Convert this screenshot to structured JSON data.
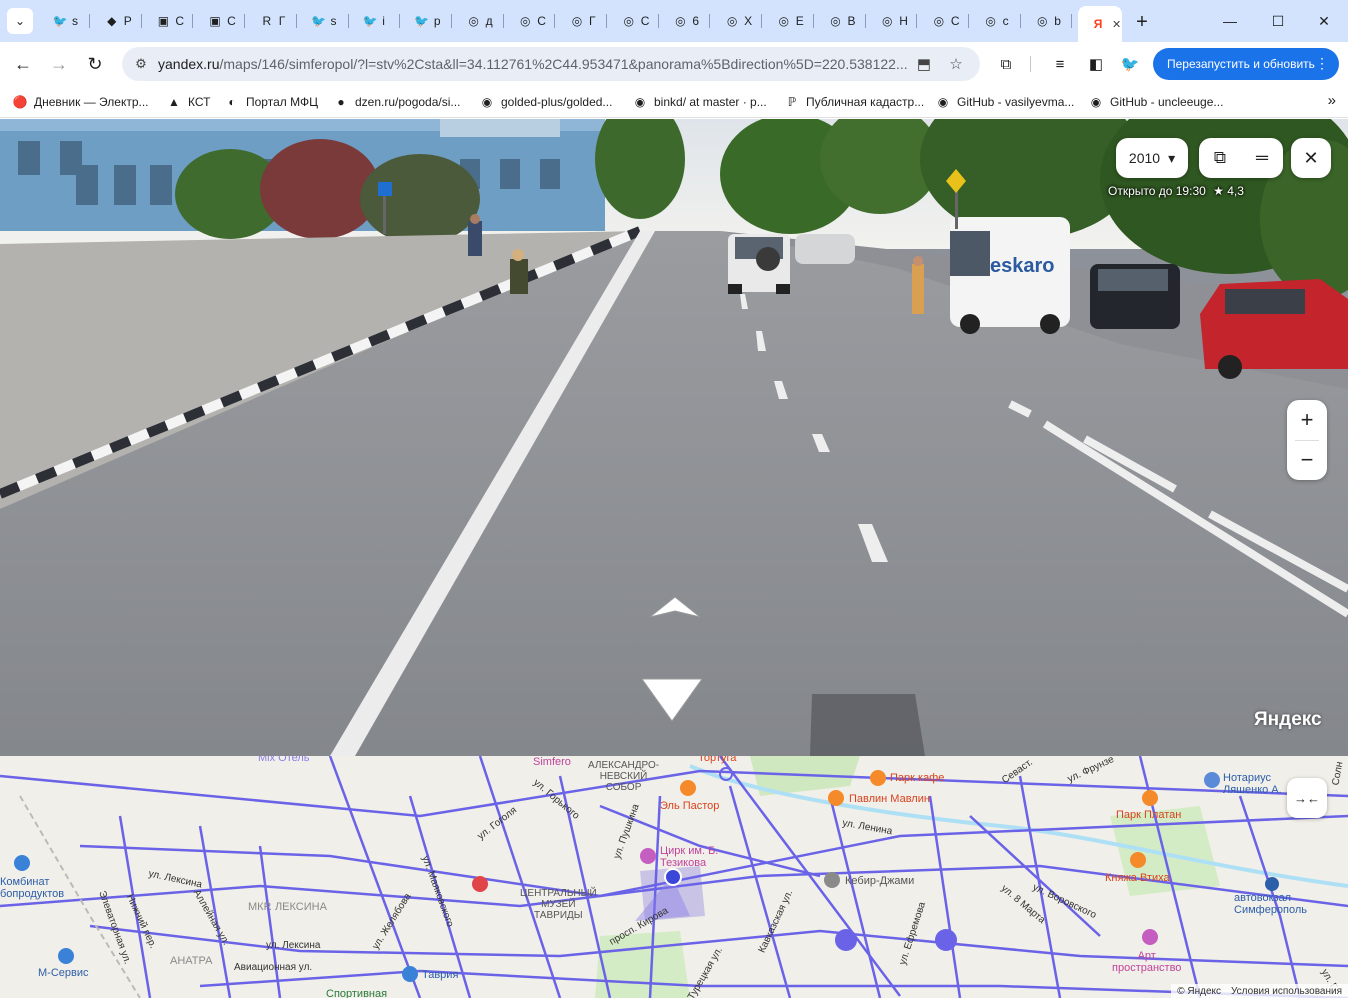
{
  "tabs": [
    {
      "fav": "🐦",
      "initial": "s"
    },
    {
      "fav": "◆",
      "initial": "P"
    },
    {
      "fav": "▣",
      "initial": "C"
    },
    {
      "fav": "▣",
      "initial": "C"
    },
    {
      "fav": "R",
      "initial": "Г"
    },
    {
      "fav": "🐦",
      "initial": "s"
    },
    {
      "fav": "🐦",
      "initial": "i"
    },
    {
      "fav": "🐦",
      "initial": "p"
    },
    {
      "fav": "◎",
      "initial": "д"
    },
    {
      "fav": "◎",
      "initial": "C"
    },
    {
      "fav": "◎",
      "initial": "Г"
    },
    {
      "fav": "◎",
      "initial": "C"
    },
    {
      "fav": "◎",
      "initial": "6"
    },
    {
      "fav": "◎",
      "initial": "X"
    },
    {
      "fav": "◎",
      "initial": "E"
    },
    {
      "fav": "◎",
      "initial": "B"
    },
    {
      "fav": "◎",
      "initial": "H"
    },
    {
      "fav": "◎",
      "initial": "C"
    },
    {
      "fav": "◎",
      "initial": "c"
    },
    {
      "fav": "◎",
      "initial": "b"
    }
  ],
  "active_tab": {
    "fav": "Я",
    "close": "✕"
  },
  "new_tab": "+",
  "window": {
    "minimize": "—",
    "maximize": "☐",
    "close": "✕"
  },
  "toolbar": {
    "back": "←",
    "forward": "→",
    "reload": "↻",
    "url_host": "yandex.ru",
    "url_path": "/maps/146/simferopol/?l=stv%2Csta&ll=34.112761%2C44.953471&panorama%5Bdirection%5D=220.538122...",
    "relaunch_label": "Перезапустить и обновить"
  },
  "bookmarks": [
    {
      "icon": "🔴",
      "label": "Дневник — Электр..."
    },
    {
      "icon": "▲",
      "label": "КСТ"
    },
    {
      "icon": "◐",
      "label": "Портал МФЦ"
    },
    {
      "icon": "●",
      "label": "dzen.ru/pogoda/si..."
    },
    {
      "icon": "◉",
      "label": "golded-plus/golded..."
    },
    {
      "icon": "◉",
      "label": "binkd/ at master · p..."
    },
    {
      "icon": "ℙ",
      "label": "Публичная кадастр..."
    },
    {
      "icon": "◉",
      "label": "GitHub - vasilyevma..."
    },
    {
      "icon": "◉",
      "label": "GitHub - uncleeuge..."
    }
  ],
  "bookmarks_more": "»",
  "panorama": {
    "year": "2010",
    "year_caret": "▾",
    "poi_hours": "Открыто до 19:30",
    "poi_rating": "★ 4,3",
    "van_text": "eskaro",
    "logo": "Яндекс",
    "zoom_in": "+",
    "zoom_out": "−"
  },
  "map": {
    "labels": {
      "mix_hotel": "Mix Отель",
      "simfero": "Simfero",
      "sobor": "АЛЕКСАНДРО-\nНЕВСКИЙ\nСОБОР",
      "tortuga": "Тортуга",
      "park_cafe": "Парк кафе",
      "pavlin": "Павлин Мавлин",
      "el_pastor": "Эль Пастор",
      "notarius": "Нотариус\nЛяшенко А.",
      "park_platan": "Парк Платан",
      "circus": "Цирк им. Б.\nТезикова",
      "kebir": "Кебир-Джами",
      "knyazha": "Княжа Втиха",
      "avtovokzal": "автовокзал\nСимферополь",
      "kombinat": "Комбинат\nбопродуктов",
      "museum": "ЦЕНТРАЛЬНЫЙ\nМУЗЕЙ\nТАВРИДЫ",
      "mkr_lieksina": "МКР. ЛЕКСИНА",
      "anatra": "АНАТРА",
      "m_service": "М-Сервис",
      "tavria": "Таврия",
      "sportivnaya": "Спортивная",
      "art": "Арт\nпространство",
      "st_lenina": "ул. Ленина",
      "st_gogolya": "ул. Гоголя",
      "st_gorkogo": "ул. Горького",
      "st_pushkina": "ул. Пушкина",
      "st_lieksina": "ул. Лексина",
      "st_lieksina2": "ул. Лексина",
      "st_zhelyabova": "ул. Желябова",
      "st_mayakovskogo": "ул. Маяковского",
      "st_kirova": "просп. Кирова",
      "st_aviacionnaya": "Авиационная ул.",
      "st_efremova": "ул. Ефремова",
      "st_8marta": "ул. 8 Марта",
      "st_vorovskogo": "ул. Воровского",
      "st_frunze": "ул. Фрунзе",
      "st_kavkazskaya": "Кавказская ул.",
      "st_turecheskaya": "Турецкая ул.",
      "st_elevatornaya": "Элеваторная ул.",
      "st_nizhniy": "Нижний пер.",
      "st_aleynaya": "Аллейная ул.",
      "st_sevasto": "Севаст.",
      "st_soln": "Солн",
      "st_ul": "ул. Г"
    },
    "collapse": "→←",
    "copyright": "© Яндекс",
    "terms": "Условия использования"
  }
}
